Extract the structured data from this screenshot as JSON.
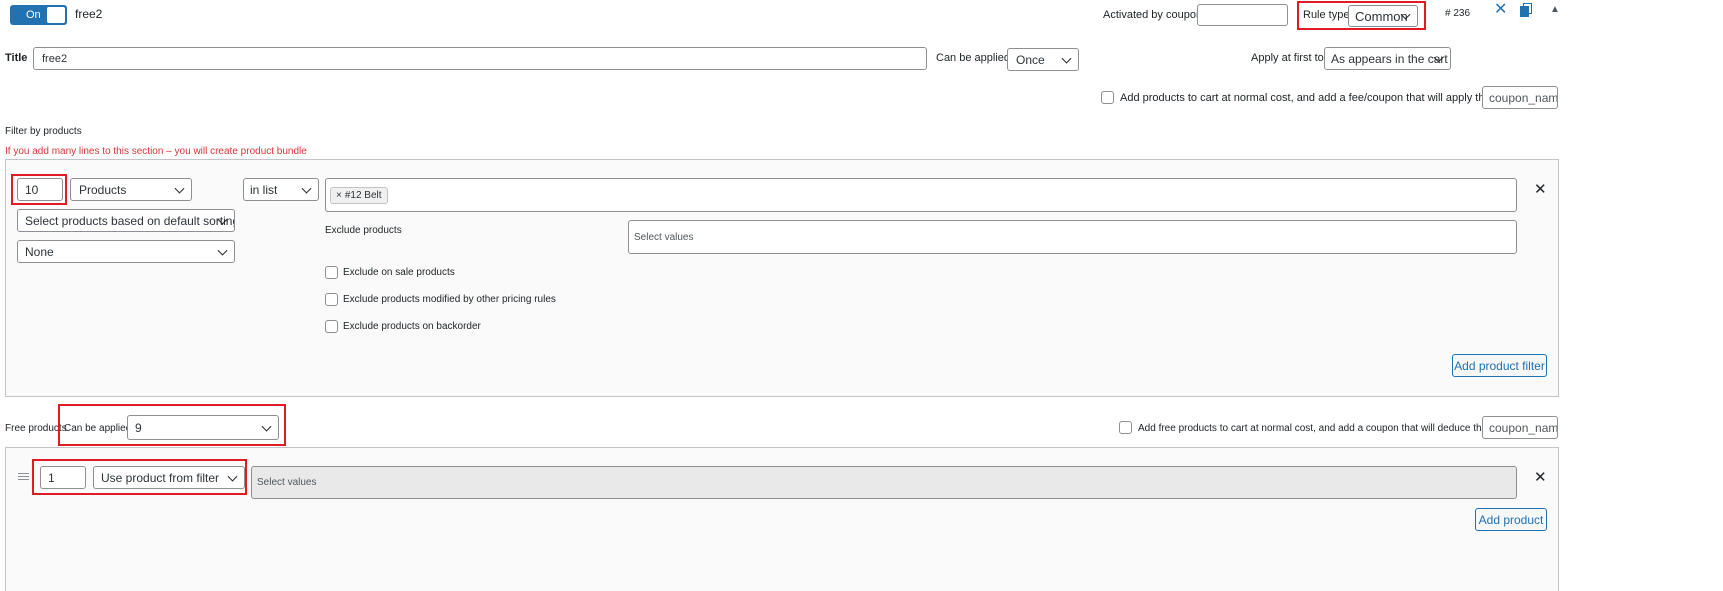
{
  "header": {
    "toggle_label": "On",
    "rule_name": "free2",
    "activated_by_coupon_label": "Activated by coupon",
    "activated_by_coupon_value": "",
    "rule_type_label": "Rule type",
    "rule_type_value": "Common",
    "rule_id": "# 236"
  },
  "title_row": {
    "title_label": "Title",
    "title_value": "free2",
    "can_be_applied_label": "Can be applied:",
    "can_be_applied_value": "Once",
    "apply_first_label": "Apply at first to:",
    "apply_first_value": "As appears in the cart"
  },
  "normal_cost_option": {
    "label": "Add products to cart at normal cost, and add a fee/coupon that will apply that cost",
    "coupon_placeholder": "coupon_name"
  },
  "filter_section": {
    "heading": "Filter by products",
    "warning": "If you add many lines to this section – you will create product bundle",
    "qty_value": "10",
    "type_value": "Products",
    "sorting_value": "Select products based on default sorting",
    "none_value": "None",
    "operator_value": "in list",
    "selected_tag": "#12 Belt",
    "exclude_label": "Exclude products",
    "exclude_placeholder": "Select values",
    "exclude_on_sale": "Exclude on sale products",
    "exclude_modified": "Exclude products modified by other pricing rules",
    "exclude_backorder": "Exclude products on backorder",
    "add_filter_button": "Add product filter"
  },
  "free_section": {
    "label": "Free products",
    "can_be_applied_label": "Can be applied",
    "can_be_applied_value": "9",
    "normal_cost_label": "Add free products to cart at normal cost, and add a coupon that will deduce that cost",
    "coupon_placeholder": "coupon_name",
    "qty_value": "1",
    "source_value": "Use product from filter",
    "values_placeholder": "Select values",
    "add_product_button": "Add product"
  },
  "colors": {
    "accent": "#2271b1",
    "highlight": "#e01b24",
    "warning_text": "#d63638"
  }
}
